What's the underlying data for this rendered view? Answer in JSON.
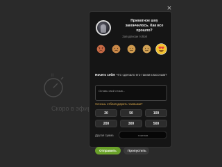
{
  "background": {
    "top_bar_items": [
      "",
      "",
      "",
      "",
      ""
    ],
    "message": "Скоро в эфире буду онлайн",
    "timer_icon": "stopwatch-icon",
    "timer_label": "II"
  },
  "overlay": {
    "close_icon": "close-icon",
    "close_glyph": "×"
  },
  "modal": {
    "title": "Приватное шоу закончилось. Как все прошло?",
    "host_subtitle": "Заподписан тобой",
    "reactions": [
      {
        "name": "angry",
        "label": "",
        "color": "#c76a45"
      },
      {
        "name": "sad",
        "label": "",
        "color": "#c98848"
      },
      {
        "name": "neutral",
        "label": "",
        "color": "#cf9a4e"
      },
      {
        "name": "smile",
        "label": "",
        "color": "#d1a155"
      },
      {
        "name": "love",
        "label": "",
        "color": "#f2c230",
        "selected": true
      }
    ],
    "compliment_strong": "Ничего себе!",
    "compliment_rest": "Что сделало его таким классным?",
    "comment_placeholder": "Оставь свой отзыв...",
    "tip_label": "Хочешь отблагодарить чаевыми?",
    "tips": [
      "20",
      "50",
      "100",
      "200",
      "300",
      "500"
    ],
    "other_amount_label": "Другая сумма",
    "other_amount_placeholder": "токенов",
    "submit_label": "Отправить",
    "skip_label": "Пропустить"
  },
  "colors": {
    "accent_green": "#6aa12a",
    "tip_label_orange": "#d9a74a",
    "modal_bg": "#151515"
  }
}
